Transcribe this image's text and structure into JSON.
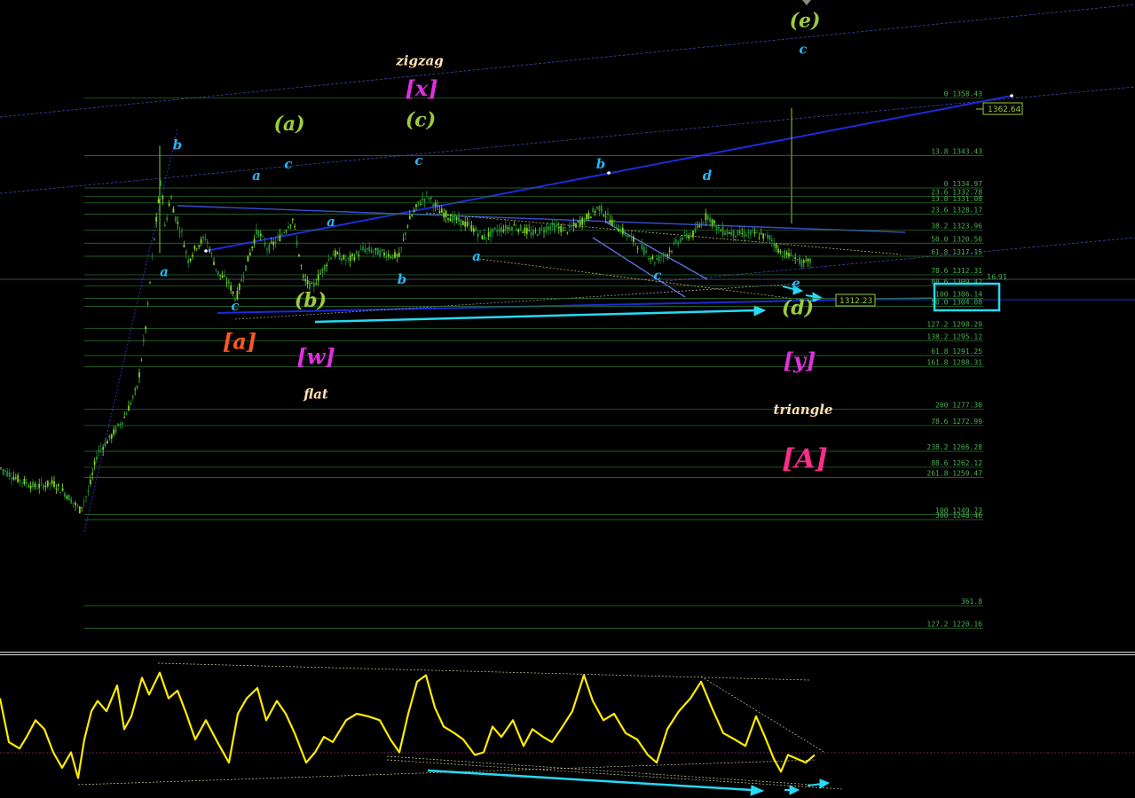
{
  "chart_data": [
    {
      "type": "candlestick",
      "title": "",
      "ylim": [
        1214,
        1384
      ],
      "current_price": "1312.23",
      "line_price_label": "1362.64",
      "price_path": [
        {
          "x": 0,
          "y": 1262
        },
        {
          "x": 20,
          "y": 1259
        },
        {
          "x": 40,
          "y": 1257
        },
        {
          "x": 60,
          "y": 1258
        },
        {
          "x": 75,
          "y": 1255
        },
        {
          "x": 90,
          "y": 1251
        },
        {
          "x": 100,
          "y": 1256
        },
        {
          "x": 110,
          "y": 1266
        },
        {
          "x": 125,
          "y": 1270
        },
        {
          "x": 140,
          "y": 1275
        },
        {
          "x": 155,
          "y": 1283
        },
        {
          "x": 165,
          "y": 1300
        },
        {
          "x": 172,
          "y": 1318
        },
        {
          "x": 178,
          "y": 1330
        },
        {
          "x": 182,
          "y": 1338
        },
        {
          "x": 186,
          "y": 1324
        },
        {
          "x": 192,
          "y": 1333
        },
        {
          "x": 198,
          "y": 1327
        },
        {
          "x": 205,
          "y": 1323
        },
        {
          "x": 212,
          "y": 1316
        },
        {
          "x": 222,
          "y": 1320
        },
        {
          "x": 232,
          "y": 1322
        },
        {
          "x": 245,
          "y": 1313
        },
        {
          "x": 258,
          "y": 1310
        },
        {
          "x": 266,
          "y": 1306
        },
        {
          "x": 275,
          "y": 1313
        },
        {
          "x": 290,
          "y": 1324
        },
        {
          "x": 302,
          "y": 1319
        },
        {
          "x": 315,
          "y": 1322
        },
        {
          "x": 330,
          "y": 1327
        },
        {
          "x": 342,
          "y": 1311
        },
        {
          "x": 352,
          "y": 1309
        },
        {
          "x": 362,
          "y": 1313
        },
        {
          "x": 375,
          "y": 1318
        },
        {
          "x": 392,
          "y": 1316
        },
        {
          "x": 410,
          "y": 1319
        },
        {
          "x": 430,
          "y": 1318
        },
        {
          "x": 450,
          "y": 1317
        },
        {
          "x": 460,
          "y": 1326
        },
        {
          "x": 472,
          "y": 1331
        },
        {
          "x": 482,
          "y": 1333
        },
        {
          "x": 495,
          "y": 1329
        },
        {
          "x": 510,
          "y": 1327
        },
        {
          "x": 530,
          "y": 1325
        },
        {
          "x": 545,
          "y": 1322
        },
        {
          "x": 560,
          "y": 1324
        },
        {
          "x": 580,
          "y": 1325
        },
        {
          "x": 600,
          "y": 1323
        },
        {
          "x": 620,
          "y": 1325
        },
        {
          "x": 640,
          "y": 1324
        },
        {
          "x": 660,
          "y": 1327
        },
        {
          "x": 675,
          "y": 1330
        },
        {
          "x": 690,
          "y": 1326
        },
        {
          "x": 705,
          "y": 1323
        },
        {
          "x": 720,
          "y": 1320
        },
        {
          "x": 738,
          "y": 1316
        },
        {
          "x": 752,
          "y": 1318
        },
        {
          "x": 768,
          "y": 1322
        },
        {
          "x": 782,
          "y": 1323
        },
        {
          "x": 797,
          "y": 1328
        },
        {
          "x": 810,
          "y": 1324
        },
        {
          "x": 830,
          "y": 1323
        },
        {
          "x": 850,
          "y": 1323
        },
        {
          "x": 868,
          "y": 1322
        },
        {
          "x": 880,
          "y": 1318
        },
        {
          "x": 895,
          "y": 1317
        },
        {
          "x": 905,
          "y": 1315
        },
        {
          "x": 915,
          "y": 1316
        }
      ],
      "fib_levels": [
        {
          "label": "0 1358.43",
          "price": 1358.43
        },
        {
          "label": "13.8 1343.43",
          "price": 1343.43
        },
        {
          "label": "0 1334.97",
          "price": 1334.97
        },
        {
          "label": "23.6 1332.78",
          "price": 1332.78
        },
        {
          "label": "13.8 1331.08",
          "price": 1331.08
        },
        {
          "label": "23.6 1328.17",
          "price": 1328.17
        },
        {
          "label": "38.2 1323.96",
          "price": 1323.96
        },
        {
          "label": "50.0 1320.56",
          "price": 1320.56
        },
        {
          "label": "61.8 1317.15",
          "price": 1317.15
        },
        {
          "label": "78.6 1312.31",
          "price": 1312.31
        },
        {
          "label": "88.6 1309.42",
          "price": 1309.42
        },
        {
          "label": "100 1306.14",
          "price": 1306.14
        },
        {
          "label": "50.0 1304.08",
          "price": 1304.08
        },
        {
          "label": "127.2 1298.29",
          "price": 1298.29
        },
        {
          "label": "138.2 1295.12",
          "price": 1295.12
        },
        {
          "label": "61.8 1291.25",
          "price": 1291.25
        },
        {
          "label": "161.8 1288.31",
          "price": 1288.31
        },
        {
          "label": "200 1277.30",
          "price": 1277.3
        },
        {
          "label": "78.6 1272.99",
          "price": 1272.99
        },
        {
          "label": "238.2 1266.28",
          "price": 1266.28
        },
        {
          "label": "88.6 1262.12",
          "price": 1262.12
        },
        {
          "label": "261.8 1259.47",
          "price": 1259.47
        },
        {
          "label": "100 1249.73",
          "price": 1249.73
        },
        {
          "label": "300 1248.46",
          "price": 1248.46
        },
        {
          "label": "361.8",
          "price": 1226
        },
        {
          "label": "127.2 1220.16",
          "price": 1220.16
        }
      ],
      "extra_price_label": "16.91",
      "wave_labels": [
        {
          "text": "b",
          "color": "#29b6f6",
          "x": 200,
          "y": 1345
        },
        {
          "text": "a",
          "color": "#29b6f6",
          "x": 185,
          "y": 1312
        },
        {
          "text": "c",
          "color": "#29b6f6",
          "x": 265,
          "y": 1303
        },
        {
          "text": "[a]",
          "color": "#ff5722",
          "x": 270,
          "y": 1293
        },
        {
          "text": "a",
          "color": "#29b6f6",
          "x": 289,
          "y": 1337
        },
        {
          "text": "c",
          "color": "#29b6f6",
          "x": 325,
          "y": 1340
        },
        {
          "text": "(a)",
          "color": "#9ccc3c",
          "x": 326,
          "y": 1350
        },
        {
          "text": "a",
          "color": "#29b6f6",
          "x": 373,
          "y": 1325
        },
        {
          "text": "(b)",
          "color": "#9ccc3c",
          "x": 350,
          "y": 1304
        },
        {
          "text": "[w]",
          "color": "#e030e0",
          "x": 356,
          "y": 1289
        },
        {
          "text": "flat",
          "color": "#ffe0b0",
          "x": 356,
          "y": 1280
        },
        {
          "text": "zigzag",
          "color": "#ffe0b0",
          "x": 473,
          "y": 1367
        },
        {
          "text": "[x]",
          "color": "#e030e0",
          "x": 475,
          "y": 1359
        },
        {
          "text": "(c)",
          "color": "#9ccc3c",
          "x": 474,
          "y": 1351
        },
        {
          "text": "c",
          "color": "#29b6f6",
          "x": 472,
          "y": 1341
        },
        {
          "text": "b",
          "color": "#29b6f6",
          "x": 453,
          "y": 1310
        },
        {
          "text": "a",
          "color": "#29b6f6",
          "x": 537,
          "y": 1316
        },
        {
          "text": "b",
          "color": "#29b6f6",
          "x": 677,
          "y": 1340
        },
        {
          "text": "c",
          "color": "#29b6f6",
          "x": 741,
          "y": 1311
        },
        {
          "text": "d",
          "color": "#29b6f6",
          "x": 797,
          "y": 1337
        },
        {
          "text": "(e)",
          "color": "#9ccc3c",
          "x": 907,
          "y": 1377
        },
        {
          "text": "c",
          "color": "#29b6f6",
          "x": 905,
          "y": 1370
        },
        {
          "text": "e",
          "color": "#29b6f6",
          "x": 897,
          "y": 1309
        },
        {
          "text": "(d)",
          "color": "#9ccc3c",
          "x": 899,
          "y": 1302
        },
        {
          "text": "[y]",
          "color": "#e030e0",
          "x": 901,
          "y": 1288
        },
        {
          "text": "triangle",
          "color": "#ffe0b0",
          "x": 905,
          "y": 1276
        },
        {
          "text": "[A]",
          "color": "#ff2d8a",
          "x": 907,
          "y": 1262
        }
      ]
    },
    {
      "type": "line",
      "title": "",
      "ylim": [
        0,
        100
      ],
      "series": [
        {
          "color": "#ffeb00",
          "values": [
            {
              "x": 0,
              "y": 72
            },
            {
              "x": 10,
              "y": 38
            },
            {
              "x": 22,
              "y": 33
            },
            {
              "x": 30,
              "y": 42
            },
            {
              "x": 40,
              "y": 55
            },
            {
              "x": 50,
              "y": 48
            },
            {
              "x": 60,
              "y": 30
            },
            {
              "x": 70,
              "y": 18
            },
            {
              "x": 80,
              "y": 30
            },
            {
              "x": 88,
              "y": 10
            },
            {
              "x": 95,
              "y": 40
            },
            {
              "x": 103,
              "y": 62
            },
            {
              "x": 110,
              "y": 70
            },
            {
              "x": 120,
              "y": 62
            },
            {
              "x": 132,
              "y": 82
            },
            {
              "x": 140,
              "y": 48
            },
            {
              "x": 148,
              "y": 58
            },
            {
              "x": 160,
              "y": 88
            },
            {
              "x": 168,
              "y": 75
            },
            {
              "x": 180,
              "y": 92
            },
            {
              "x": 190,
              "y": 72
            },
            {
              "x": 200,
              "y": 78
            },
            {
              "x": 210,
              "y": 60
            },
            {
              "x": 220,
              "y": 40
            },
            {
              "x": 232,
              "y": 55
            },
            {
              "x": 245,
              "y": 38
            },
            {
              "x": 258,
              "y": 22
            },
            {
              "x": 268,
              "y": 60
            },
            {
              "x": 278,
              "y": 72
            },
            {
              "x": 290,
              "y": 80
            },
            {
              "x": 300,
              "y": 55
            },
            {
              "x": 312,
              "y": 70
            },
            {
              "x": 322,
              "y": 60
            },
            {
              "x": 332,
              "y": 45
            },
            {
              "x": 345,
              "y": 22
            },
            {
              "x": 355,
              "y": 30
            },
            {
              "x": 365,
              "y": 42
            },
            {
              "x": 375,
              "y": 38
            },
            {
              "x": 390,
              "y": 55
            },
            {
              "x": 402,
              "y": 60
            },
            {
              "x": 415,
              "y": 58
            },
            {
              "x": 428,
              "y": 55
            },
            {
              "x": 440,
              "y": 40
            },
            {
              "x": 450,
              "y": 30
            },
            {
              "x": 460,
              "y": 60
            },
            {
              "x": 470,
              "y": 85
            },
            {
              "x": 480,
              "y": 90
            },
            {
              "x": 490,
              "y": 65
            },
            {
              "x": 500,
              "y": 50
            },
            {
              "x": 512,
              "y": 45
            },
            {
              "x": 522,
              "y": 40
            },
            {
              "x": 535,
              "y": 28
            },
            {
              "x": 545,
              "y": 30
            },
            {
              "x": 555,
              "y": 50
            },
            {
              "x": 565,
              "y": 42
            },
            {
              "x": 578,
              "y": 55
            },
            {
              "x": 590,
              "y": 35
            },
            {
              "x": 600,
              "y": 48
            },
            {
              "x": 612,
              "y": 42
            },
            {
              "x": 622,
              "y": 38
            },
            {
              "x": 632,
              "y": 48
            },
            {
              "x": 645,
              "y": 62
            },
            {
              "x": 658,
              "y": 90
            },
            {
              "x": 668,
              "y": 70
            },
            {
              "x": 680,
              "y": 55
            },
            {
              "x": 692,
              "y": 60
            },
            {
              "x": 705,
              "y": 45
            },
            {
              "x": 718,
              "y": 40
            },
            {
              "x": 730,
              "y": 28
            },
            {
              "x": 740,
              "y": 22
            },
            {
              "x": 752,
              "y": 48
            },
            {
              "x": 765,
              "y": 62
            },
            {
              "x": 778,
              "y": 72
            },
            {
              "x": 790,
              "y": 85
            },
            {
              "x": 802,
              "y": 65
            },
            {
              "x": 815,
              "y": 45
            },
            {
              "x": 828,
              "y": 40
            },
            {
              "x": 840,
              "y": 35
            },
            {
              "x": 852,
              "y": 58
            },
            {
              "x": 862,
              "y": 42
            },
            {
              "x": 872,
              "y": 25
            },
            {
              "x": 880,
              "y": 15
            },
            {
              "x": 888,
              "y": 28
            },
            {
              "x": 898,
              "y": 25
            },
            {
              "x": 908,
              "y": 22
            },
            {
              "x": 918,
              "y": 28
            }
          ]
        }
      ]
    }
  ]
}
